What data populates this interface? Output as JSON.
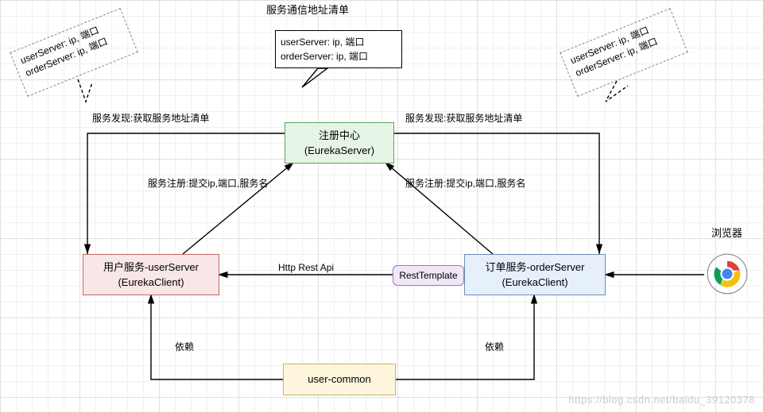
{
  "title": "服务通信地址清单",
  "noteLeft": {
    "line1": "userServer: ip, 端口",
    "line2": "orderServer: ip, 端口"
  },
  "noteRight": {
    "line1": "userServer: ip, 端口",
    "line2": "orderServer: ip, 端口"
  },
  "speech": {
    "line1": "userServer: ip, 端口",
    "line2": "orderServer: ip, 端口"
  },
  "registry": {
    "line1": "注册中心",
    "line2": "(EurekaServer)"
  },
  "userServer": {
    "line1": "用户服务-userServer",
    "line2": "(EurekaClient)"
  },
  "orderServer": {
    "line1": "订单服务-orderServer",
    "line2": "(EurekaClient)"
  },
  "restTemplate": "RestTemplate",
  "userCommon": "user-common",
  "browser": "浏览器",
  "labels": {
    "discoverLeft": "服务发现:获取服务地址清单",
    "discoverRight": "服务发现:获取服务地址清单",
    "registerLeft": "服务注册:提交ip,端口,服务名",
    "registerRight": "服务注册:提交ip,端口,服务名",
    "httpApi": "Http Rest Api",
    "dependLeft": "依赖",
    "dependRight": "依赖"
  },
  "watermark": "https://blog.csdn.net/baidu_39120378"
}
